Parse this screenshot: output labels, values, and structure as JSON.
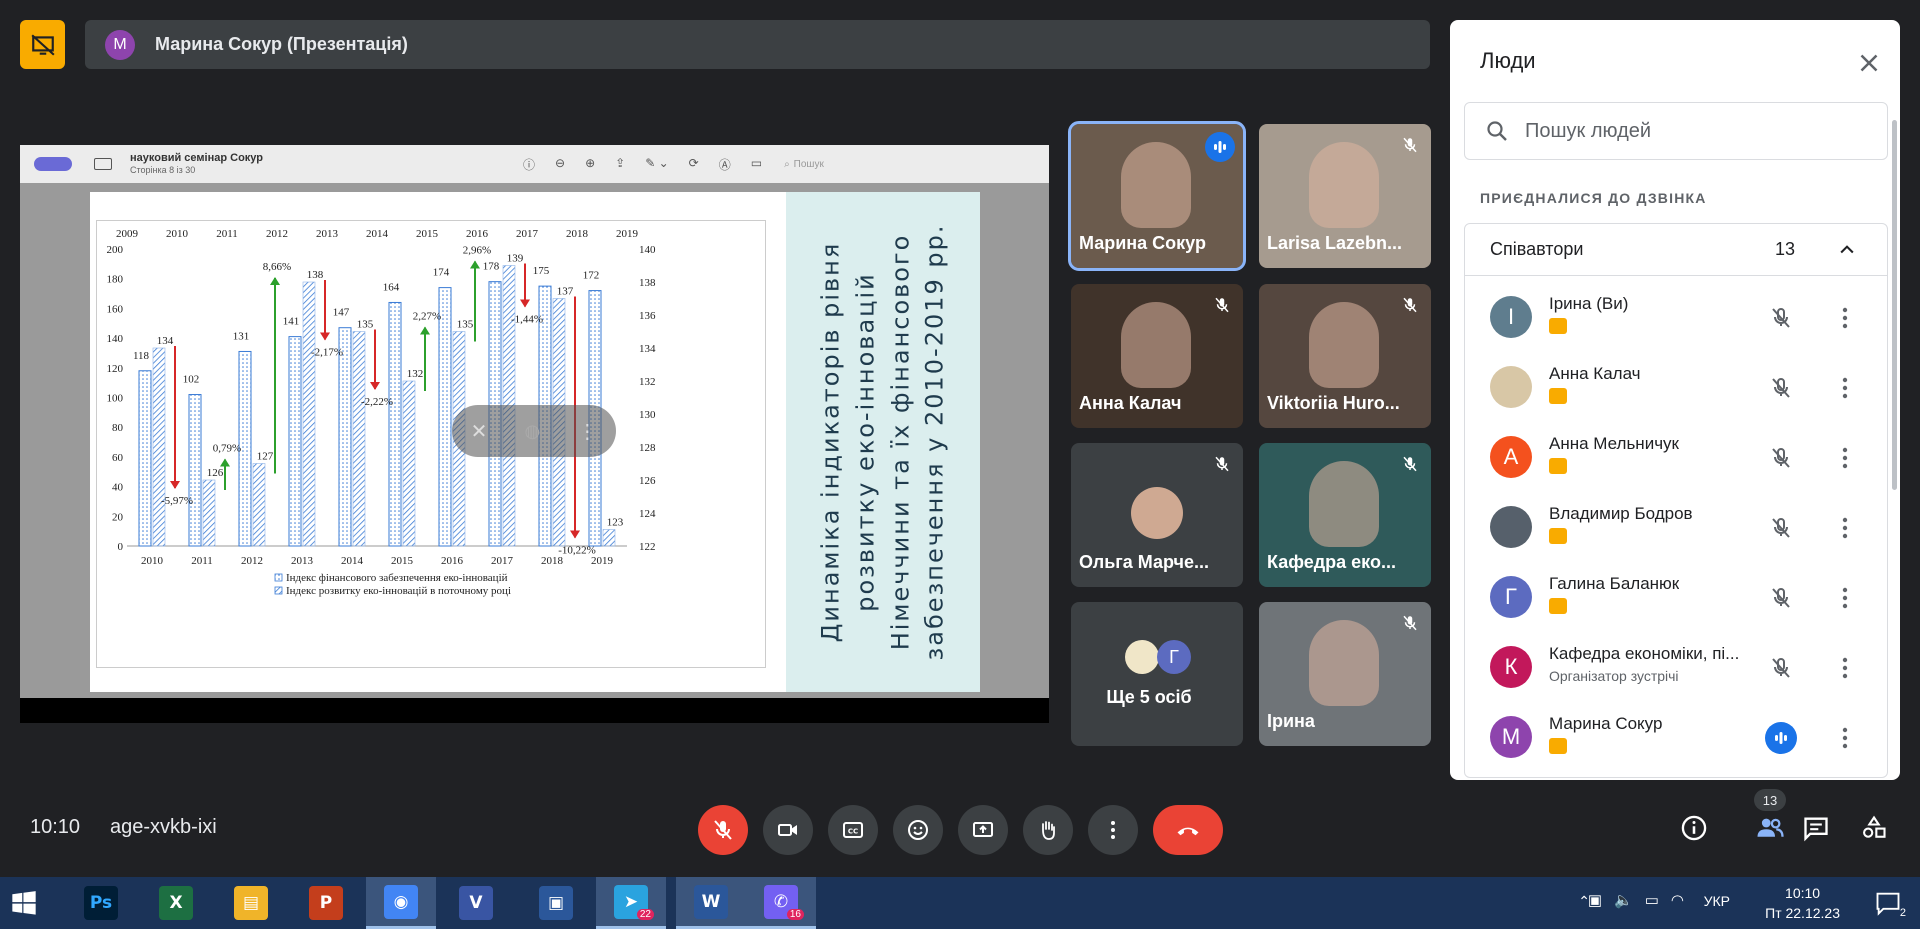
{
  "presentation": {
    "presenter_initial": "М",
    "title": "Марина Сокур (Презентація)"
  },
  "viewer": {
    "doc_name": "науковий семінар Сокур",
    "page_info": "Сторінка 8 із 30",
    "search_placeholder": "Пошук"
  },
  "slide": {
    "title_lines": [
      "Динаміка індикаторів рівня",
      "розвитку еко-інновацій",
      "Німеччини та їх фінансового",
      "забезпечення у 2010-2019 рр."
    ]
  },
  "chart_data": {
    "type": "bar",
    "categories": [
      "2010",
      "2011",
      "2012",
      "2013",
      "2014",
      "2015",
      "2016",
      "2017",
      "2018",
      "2019"
    ],
    "top_axis_labels": [
      "2009",
      "2010",
      "2011",
      "2012",
      "2013",
      "2014",
      "2015",
      "2016",
      "2017",
      "2018",
      "2019"
    ],
    "series": [
      {
        "name": "Індекс фінансового забезпечення еко-інновацій",
        "axis": "left",
        "values": [
          118,
          102,
          131,
          141,
          147,
          164,
          174,
          178,
          175,
          172
        ]
      },
      {
        "name": "Індекс розвитку еко-інновацій в поточному році",
        "axis": "right",
        "values": [
          134,
          126,
          127,
          138,
          135,
          132,
          135,
          139,
          137,
          123
        ]
      }
    ],
    "ylim_left": [
      0,
      200
    ],
    "yticks_left": [
      0,
      20,
      40,
      60,
      80,
      100,
      120,
      140,
      160,
      180,
      200
    ],
    "ylim_right": [
      122,
      140
    ],
    "yticks_right": [
      122,
      124,
      126,
      128,
      130,
      132,
      134,
      136,
      138,
      140
    ],
    "annotations": [
      {
        "text": "-5,97%",
        "direction": "down",
        "color": "#d62728"
      },
      {
        "text": "0,79%",
        "direction": "up",
        "color": "#2ca02c"
      },
      {
        "text": "8,66%",
        "direction": "up",
        "color": "#2ca02c"
      },
      {
        "text": "-2,17%",
        "direction": "down",
        "color": "#d62728"
      },
      {
        "text": "-2,22%",
        "direction": "down",
        "color": "#d62728"
      },
      {
        "text": "2,27%",
        "direction": "up",
        "color": "#2ca02c"
      },
      {
        "text": "2,96%",
        "direction": "up",
        "color": "#2ca02c"
      },
      {
        "text": "-1,44%",
        "direction": "down",
        "color": "#d62728"
      },
      {
        "text": "-10,22%",
        "direction": "down",
        "color": "#d62728"
      }
    ]
  },
  "tiles": [
    {
      "name": "Марина Сокур",
      "speaking": true,
      "accent": "#8ab4f8"
    },
    {
      "name": "Larisa Lazebn...",
      "muted": true
    },
    {
      "name": "Анна Калач",
      "muted": true
    },
    {
      "name": "Viktoriia Huro...",
      "muted": true
    },
    {
      "name": "Ольга Марче...",
      "muted": true
    },
    {
      "name": "Кафедра еко...",
      "muted": true
    },
    {
      "name": "Ще 5 осіб",
      "initial": "Г"
    },
    {
      "name": "Ірина",
      "muted": true
    }
  ],
  "people_panel": {
    "title": "Люди",
    "search_placeholder": "Пошук людей",
    "joined_label": "ПРИЄДНАЛИСЯ ДО ДЗВІНКА",
    "group_label": "Співавтори",
    "group_count": "13",
    "people": [
      {
        "name": "Ірина (Ви)",
        "initial": "І",
        "color": "#5f7d8e"
      },
      {
        "name": "Анна Калач",
        "initial": "",
        "color": "#d8c7a6"
      },
      {
        "name": "Анна Мельничук",
        "initial": "А",
        "color": "#f4511e"
      },
      {
        "name": "Владимир Бодров",
        "initial": "",
        "color": "#56606b"
      },
      {
        "name": "Галина Баланюк",
        "initial": "Г",
        "color": "#5c6bc0"
      },
      {
        "name": "Кафедра економіки, пі...",
        "initial": "К",
        "color": "#c2185b",
        "subtitle": "Організатор зустрічі"
      },
      {
        "name": "Марина Сокур",
        "initial": "М",
        "color": "#8e44ad",
        "speaking": true
      }
    ]
  },
  "bottom": {
    "time": "10:10",
    "meeting_code": "age-xvkb-ixi",
    "people_count": "13"
  },
  "taskbar": {
    "apps": [
      {
        "label": "Ps",
        "color": "#001e36",
        "fg": "#31a8ff"
      },
      {
        "label": "X",
        "color": "#1d6f42"
      },
      {
        "label": "▤",
        "color": "#f0b429"
      },
      {
        "label": "P",
        "color": "#c43e1c"
      },
      {
        "label": "◉",
        "color": "#4285f4",
        "active": true
      },
      {
        "label": "V",
        "color": "#3955a3"
      },
      {
        "label": "▣",
        "color": "#2b579a"
      },
      {
        "label": "➤",
        "color": "#2aa3df",
        "badge": "22",
        "active": true
      },
      {
        "label": "W",
        "color": "#2b579a",
        "active": true
      },
      {
        "label": "✆",
        "color": "#7360f2",
        "badge": "16",
        "active": true
      }
    ],
    "lang": "УКР",
    "clock_time": "10:10",
    "clock_date": "Пт 22.12.23",
    "notif_count": "2"
  }
}
